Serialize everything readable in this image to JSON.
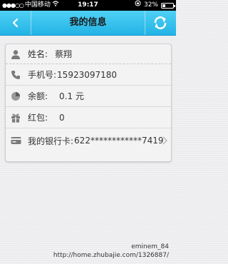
{
  "status_bar": {
    "signal": "●●●○○",
    "carrier": "中国移动",
    "time": "19:17",
    "battery_text": "32%",
    "battery_level": 0.32
  },
  "nav": {
    "title": "我的信息"
  },
  "info": {
    "name_label": "姓名:",
    "name_value": "蔡翔",
    "phone_label": "手机号:",
    "phone_value": "15923097180",
    "balance_label": "余额:",
    "balance_value": "0.1 元",
    "redpack_label": "红包:",
    "redpack_value": "0",
    "bank_label": "我的银行卡:",
    "bank_value": "622************7419"
  },
  "watermark": {
    "line1": "eminem_84",
    "line2": "http://home.zhubajie.com/1326887/"
  },
  "icons": {
    "accent": "#23b3e6",
    "icon_color": "#7a7a7a"
  }
}
